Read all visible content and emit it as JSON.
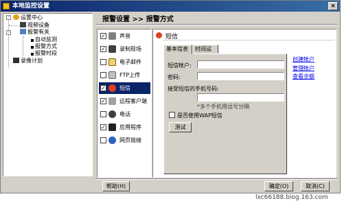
{
  "window": {
    "title": "本地监控设置",
    "close_label": "×"
  },
  "tree": {
    "items": [
      {
        "label": "设置中心"
      },
      {
        "label": "视频设备"
      },
      {
        "label": "报警有关"
      },
      {
        "label": "自动监测"
      },
      {
        "label": "报警方式"
      },
      {
        "label": "报警时段"
      },
      {
        "label": "录像计划"
      }
    ]
  },
  "breadcrumb": "报警设置 >> 报警方式",
  "methods": [
    {
      "label": "声音",
      "checked": true,
      "icon": "speaker-icon",
      "color": "#808080"
    },
    {
      "label": "录制现场",
      "checked": true,
      "icon": "camera-icon",
      "color": "#404040"
    },
    {
      "label": "电子邮件",
      "checked": false,
      "icon": "envelope-icon",
      "color": "#f0d070"
    },
    {
      "label": "FTP上传",
      "checked": false,
      "icon": "ftp-icon",
      "color": "#c0c0c0"
    },
    {
      "label": "短信",
      "checked": true,
      "icon": "sms-icon",
      "color": "#e04020"
    },
    {
      "label": "远程客户端",
      "checked": true,
      "icon": "remote-client-icon",
      "color": "#a0a0a0"
    },
    {
      "label": "电话",
      "checked": false,
      "icon": "phone-icon",
      "color": "#404040"
    },
    {
      "label": "应用程序",
      "checked": true,
      "icon": "application-icon",
      "color": "#202020"
    },
    {
      "label": "网页链接",
      "checked": false,
      "icon": "web-link-icon",
      "color": "#3060c0"
    }
  ],
  "panel": {
    "title": "短信",
    "tabs": [
      "基本信息",
      "时间设置"
    ],
    "account_label": "短信帐户:",
    "password_label": "密码:",
    "phone_label": "接受短信的手机号码:",
    "phone_hint": "*多个手机用逗号分隔",
    "wap_label": "是否使用WAP短信",
    "test_button": "测试",
    "links": [
      "创建帐户",
      "管理帐户",
      "查看余额"
    ]
  },
  "footer": {
    "help_button": "帮助(H)",
    "ok_button": "确定(O)",
    "cancel_button": "取消(C)"
  },
  "watermark": "lxc66188.blog.163.com"
}
